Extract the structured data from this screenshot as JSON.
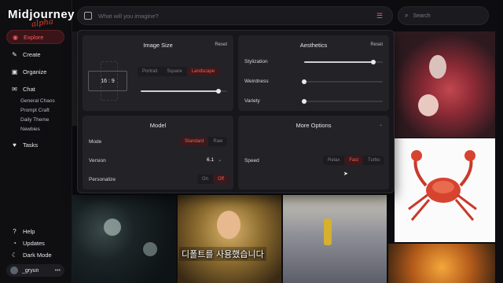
{
  "logo": {
    "text": "Midjourney",
    "badge": "alpha"
  },
  "nav": {
    "explore": "Explore",
    "create": "Create",
    "organize": "Organize",
    "chat": "Chat",
    "tasks": "Tasks",
    "chat_rooms": [
      "General Chaos",
      "Prompt Craft",
      "Daily Theme",
      "Newbies"
    ],
    "help": "Help",
    "updates": "Updates",
    "dark_mode": "Dark Mode"
  },
  "user": {
    "name": "_gryun"
  },
  "prompt": {
    "placeholder": "What will you imagine?"
  },
  "search": {
    "placeholder": "Search"
  },
  "image_size": {
    "title": "Image Size",
    "reset": "Reset",
    "ratio": "16 : 9",
    "options": [
      "Portrait",
      "Square",
      "Landscape"
    ],
    "selected": "Landscape",
    "slider_value": 0.9
  },
  "aesthetics": {
    "title": "Aesthetics",
    "reset": "Reset",
    "rows": [
      {
        "label": "Stylization",
        "value": 0.88
      },
      {
        "label": "Weirdness",
        "value": 0.0
      },
      {
        "label": "Variety",
        "value": 0.0
      }
    ]
  },
  "model": {
    "title": "Model",
    "mode_label": "Mode",
    "mode_options": [
      "Standard",
      "Raw"
    ],
    "mode_selected": "Standard",
    "version_label": "Version",
    "version_value": "6.1",
    "personalize_label": "Personalize",
    "personalize_options": [
      "On",
      "Off"
    ],
    "personalize_selected": "Off"
  },
  "more_options": {
    "title": "More Options",
    "speed_label": "Speed",
    "speed_options": [
      "Relax",
      "Fast",
      "Turbo"
    ],
    "speed_selected": "Fast"
  },
  "subtitle": "디폴트를 사용했습니다",
  "colors": {
    "accent": "#ff5a4a",
    "bg": "#0d0d10",
    "panel": "#17171b",
    "card": "#222227"
  }
}
